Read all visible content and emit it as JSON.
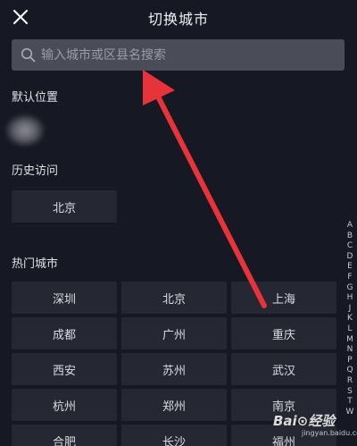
{
  "header": {
    "title": "切换城市",
    "close_icon": "close-icon"
  },
  "search": {
    "placeholder": "输入城市或区县名搜索",
    "icon": "search-icon"
  },
  "sections": {
    "default_location": "默认位置",
    "history": "历史访问",
    "hot": "热门城市"
  },
  "history_cities": [
    "北京"
  ],
  "hot_cities": [
    "深圳",
    "北京",
    "上海",
    "成都",
    "广州",
    "重庆",
    "西安",
    "苏州",
    "武汉",
    "杭州",
    "郑州",
    "南京",
    "合肥",
    "长沙",
    "福州"
  ],
  "index_letters": [
    "A",
    "B",
    "C",
    "D",
    "E",
    "F",
    "G",
    "H",
    "J",
    "K",
    "L",
    "M",
    "N",
    "P",
    "Q",
    "R",
    "S",
    "T",
    "W"
  ],
  "watermark": {
    "text": "Bai⊙经验",
    "sub": "jingyan.baidu.com"
  },
  "colors": {
    "background": "#161823",
    "chip": "#252733",
    "search_bg": "#4a4c58",
    "arrow": "#e8333a"
  }
}
